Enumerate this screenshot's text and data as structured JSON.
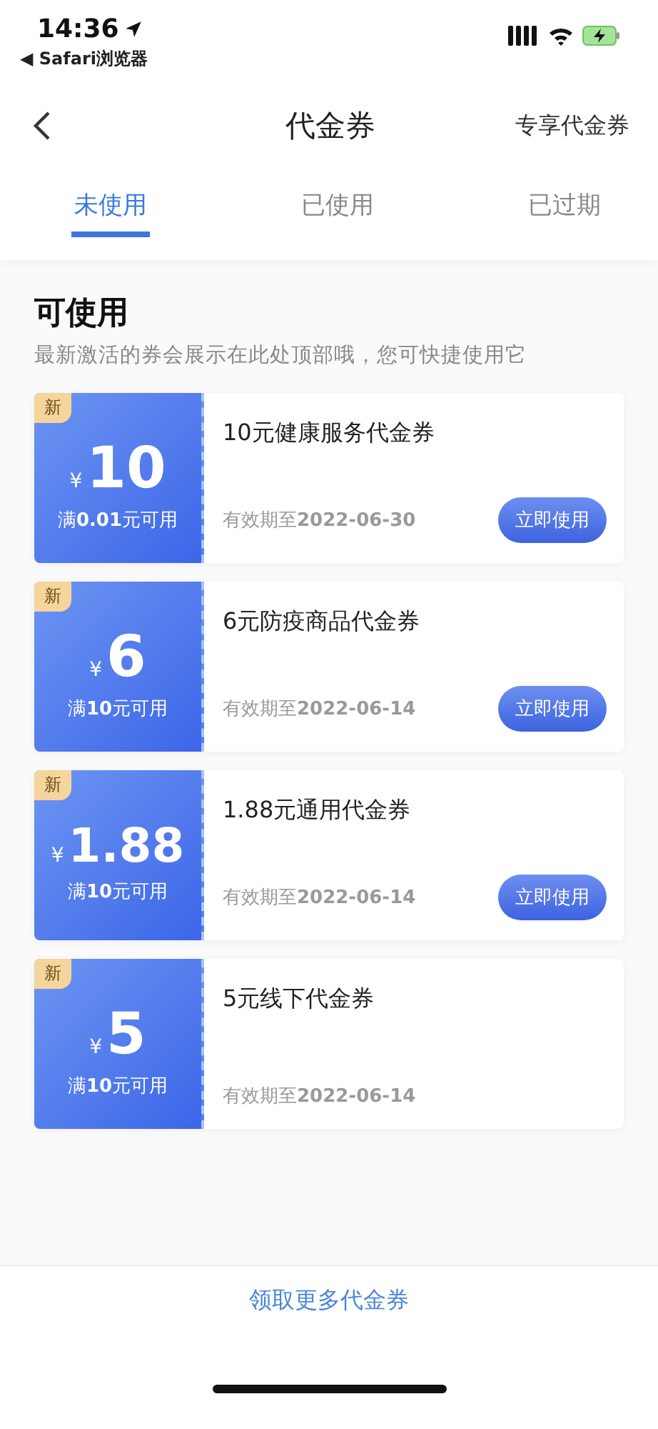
{
  "status_bar": {
    "time": "14:36",
    "back_app": "◀ Safari浏览器"
  },
  "nav": {
    "title": "代金券",
    "action": "专享代金券"
  },
  "tabs": [
    {
      "label": "未使用",
      "selected": true
    },
    {
      "label": "已使用",
      "selected": false
    },
    {
      "label": "已过期",
      "selected": false
    }
  ],
  "section": {
    "title": "可使用",
    "subtitle": "最新激活的券会展示在此处顶部哦，您可快捷使用它"
  },
  "coupons": [
    {
      "badge": "新",
      "currency": "¥",
      "amount": "10",
      "condition": "满**0.01**元可用",
      "name": "10元健康服务代金券",
      "expiry": "有效期至**2022-06-30**",
      "button": "立即使用"
    },
    {
      "badge": "新",
      "currency": "¥",
      "amount": "6",
      "condition": "满**10**元可用",
      "name": "6元防疫商品代金券",
      "expiry": "有效期至**2022-06-14**",
      "button": "立即使用"
    },
    {
      "badge": "新",
      "currency": "¥",
      "amount": "1.88",
      "condition": "满**10**元可用",
      "name": "1.88元通用代金券",
      "expiry": "有效期至**2022-06-14**",
      "button": "立即使用"
    },
    {
      "badge": "新",
      "currency": "¥",
      "amount": "5",
      "condition": "满**10**元可用",
      "name": "5元线下代金券",
      "expiry": "有效期至**2022-06-14**"
    }
  ],
  "footer": {
    "link": "领取更多代金券"
  }
}
